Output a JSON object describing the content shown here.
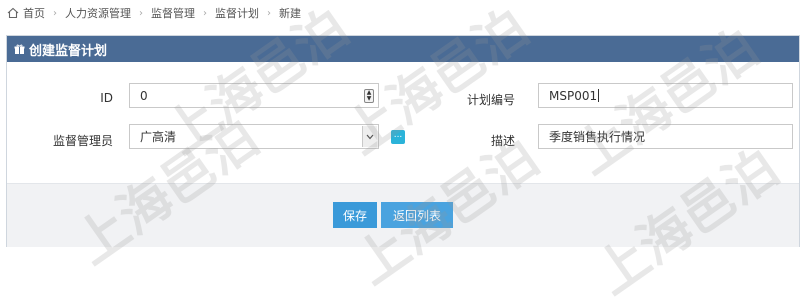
{
  "breadcrumb": {
    "items": [
      "首页",
      "人力资源管理",
      "监督管理",
      "监督计划",
      "新建"
    ]
  },
  "panel": {
    "title": "创建监督计划"
  },
  "form": {
    "id_label": "ID",
    "id_value": "0",
    "code_label": "计划编号",
    "code_value": "MSP001",
    "manager_label": "监督管理员",
    "manager_value": "广高清",
    "desc_label": "描述",
    "desc_value": "季度销售执行情况",
    "pick_button_label": "..."
  },
  "actions": {
    "save_label": "保存",
    "back_label": "返回列表"
  },
  "watermark": {
    "text": "上海邑泊"
  },
  "colors": {
    "header_bg": "#4a6b95",
    "button_bg": "#3a9ad9",
    "pick_button_bg": "#2bb3d9",
    "footer_bg": "#f1f2f4"
  },
  "icons": {
    "home": "home-icon",
    "header": "gift-icon",
    "spinner": "spinner-icon",
    "dropdown": "chevron-down-icon"
  }
}
